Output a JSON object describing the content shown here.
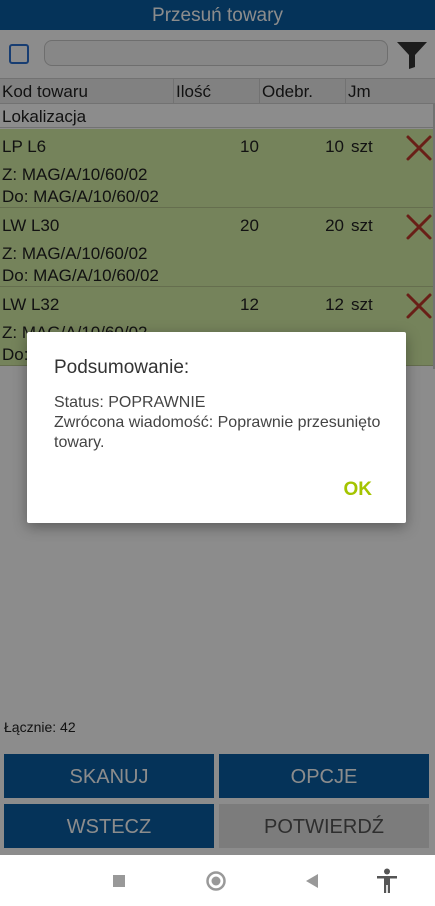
{
  "title": "Przesuń towary",
  "search": {
    "value": "",
    "placeholder": ""
  },
  "columns": [
    "Kod towaru",
    "Ilość",
    "Odebr.",
    "Jm"
  ],
  "subheader": "Lokalizacja",
  "rows": [
    {
      "code": "LP L6",
      "qty": "10",
      "received": "10",
      "unit": "szt",
      "from": "Z: MAG/A/10/60/02",
      "to": "Do: MAG/A/10/60/02"
    },
    {
      "code": "LW L30",
      "qty": "20",
      "received": "20",
      "unit": "szt",
      "from": "Z: MAG/A/10/60/02",
      "to": "Do: MAG/A/10/60/02"
    },
    {
      "code": "LW L32",
      "qty": "12",
      "received": "12",
      "unit": "szt",
      "from": "Z: MAG/A/10/60/02",
      "to": "Do: MAG/A/10/60/02"
    }
  ],
  "total": "Łącznie: 42",
  "buttons": {
    "scan": "SKANUJ",
    "options": "OPCJE",
    "back": "WSTECZ",
    "confirm": "POTWIERDŹ"
  },
  "dialog": {
    "title": "Podsumowanie:",
    "message": "Status: POPRAWNIE\nZwrócona wiadomość: Poprawnie przesunięto towary.",
    "ok": "OK"
  },
  "colors": {
    "primary": "#0a5ea3",
    "row_bg": "#d6efa6",
    "delete": "#c0392b",
    "ok": "#a4c400"
  },
  "icons": [
    "checkbox-icon",
    "filter-icon",
    "delete-icon",
    "nav-recents-icon",
    "nav-home-icon",
    "nav-back-icon",
    "accessibility-icon"
  ]
}
